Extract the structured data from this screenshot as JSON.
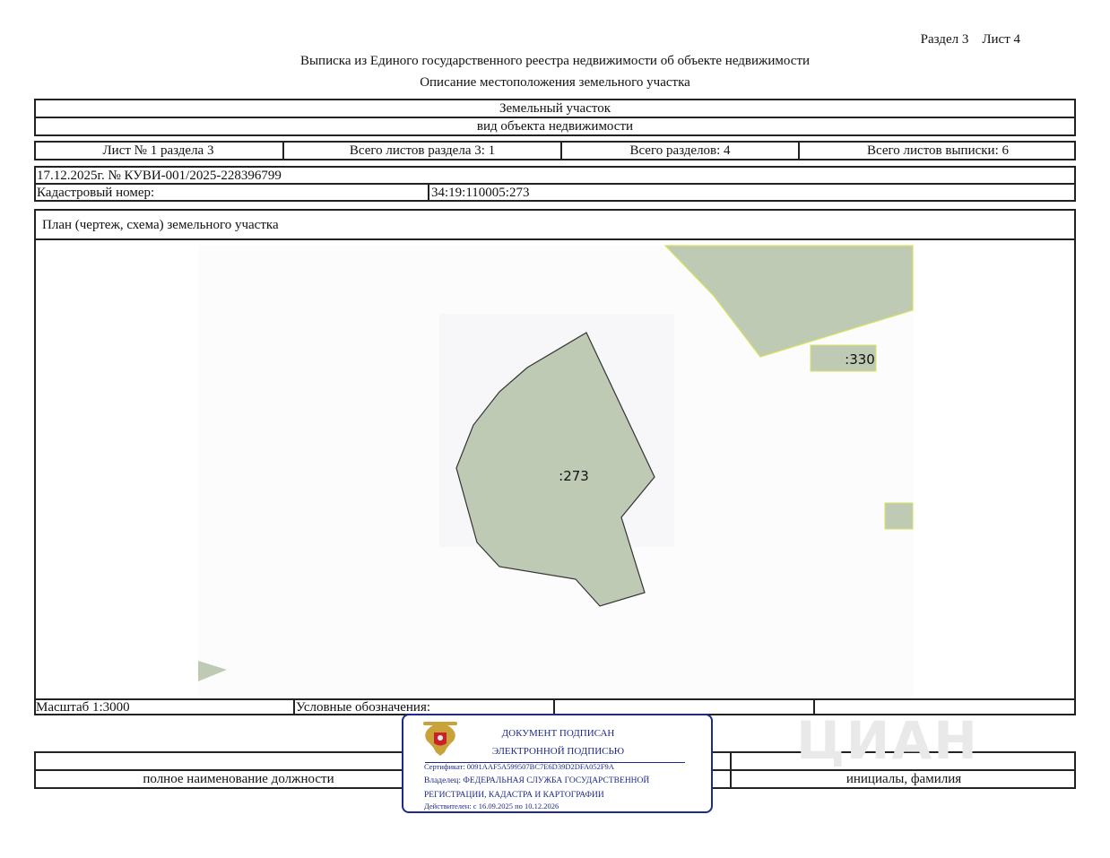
{
  "header": {
    "section_sheet": "Раздел 3    Лист 4",
    "title": "Выписка из Единого государственного реестра недвижимости об объекте недвижимости",
    "subtitle": "Описание местоположения земельного участка"
  },
  "object": {
    "kind": "Земельный участок",
    "kind_caption": "вид объекта недвижимости"
  },
  "sheets": {
    "sheet": "Лист № 1 раздела 3",
    "total_sheets_section": "Всего листов раздела 3: 1",
    "total_sections": "Всего разделов: 4",
    "total_sheets_extract": "Всего листов выписки: 6"
  },
  "doc": {
    "date_number": "17.12.2025г. № КУВИ-001/2025-228396799",
    "cadastral_label": "Кадастровый номер:",
    "cadastral_value": "34:19:110005:273"
  },
  "plan": {
    "title": "План (чертеж, схема) земельного участка",
    "labels": {
      "main": ":273",
      "neighbor": ":330"
    },
    "colors": {
      "parcel_fill": "#bfcab5",
      "parcel_edge_main": "#333333",
      "parcel_edge_neighbor": "#d6e35a"
    }
  },
  "footer": {
    "scale": "Масштаб 1:3000",
    "legend": "Условные обозначения:",
    "position_caption": "полное наименование должности",
    "initials_caption": "инициалы, фамилия"
  },
  "stamp": {
    "line1": "ДОКУМЕНТ ПОДПИСАН",
    "line2": "ЭЛЕКТРОННОЙ ПОДПИСЬЮ",
    "certificate": "Сертификат: 0091AAF5A599507BC7E6D39D2DFA052F9A",
    "owner_line1": "Владелец: ФЕДЕРАЛЬНАЯ СЛУЖБА ГОСУДАРСТВЕННОЙ",
    "owner_line2": "РЕГИСТРАЦИИ, КАДАСТРА И КАРТОГРАФИИ",
    "valid": "Действителен: с 16.09.2025 по 10.12.2026",
    "color": "#1d2a8a"
  },
  "watermark": {
    "text": "ЦИАН"
  }
}
